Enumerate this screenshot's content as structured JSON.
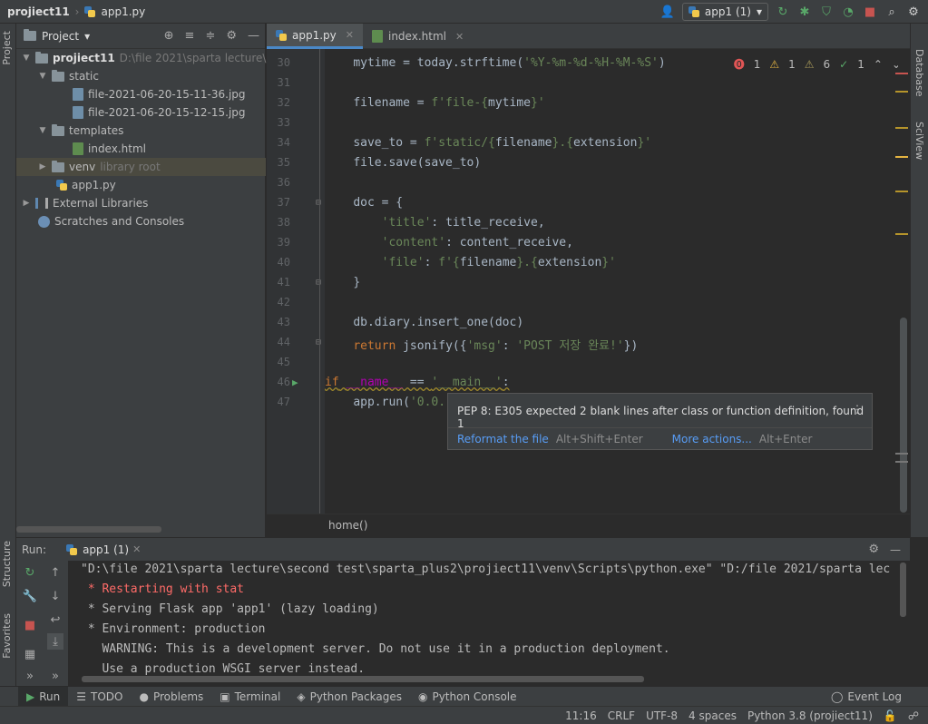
{
  "navbar": {
    "project": "projiect11",
    "file": "app1.py"
  },
  "toolbar": {
    "run_config": "app1 (1)"
  },
  "left_strip": {
    "project_label": "Project",
    "structure_label": "Structure",
    "favorites_label": "Favorites"
  },
  "right_strip": {
    "database_label": "Database",
    "sciview_label": "SciView"
  },
  "project_panel": {
    "title": "Project",
    "root": {
      "name": "projiect11",
      "path": "D:\\file 2021\\sparta lecture\\se"
    },
    "static": "static",
    "file1": "file-2021-06-20-15-11-36.jpg",
    "file2": "file-2021-06-20-15-12-15.jpg",
    "templates": "templates",
    "index": "index.html",
    "venv": "venv",
    "venv_hint": "library root",
    "app": "app1.py",
    "ext_libs": "External Libraries",
    "scratches": "Scratches and Consoles"
  },
  "editor": {
    "tabs": [
      {
        "label": "app1.py"
      },
      {
        "label": "index.html"
      }
    ],
    "inspections": {
      "errors": "1",
      "warnings": "1",
      "weak_warnings": "6",
      "typos": "1"
    },
    "line_numbers": [
      "30",
      "31",
      "32",
      "33",
      "34",
      "35",
      "36",
      "37",
      "38",
      "39",
      "40",
      "41",
      "42",
      "43",
      "44",
      "45",
      "46",
      "47"
    ],
    "breadcrumb": "home()"
  },
  "tooltip": {
    "message": "PEP 8: E305 expected 2 blank lines after class or function definition, found 1",
    "action1": "Reformat the file",
    "shortcut1": "Alt+Shift+Enter",
    "action2": "More actions...",
    "shortcut2": "Alt+Enter"
  },
  "run": {
    "label": "Run:",
    "tab": "app1 (1)",
    "console": [
      "\"D:\\file 2021\\sparta lecture\\second test\\sparta_plus2\\projiect11\\venv\\Scripts\\python.exe\" \"D:/file 2021/sparta lec",
      " * Restarting with stat",
      " * Serving Flask app 'app1' (lazy loading)",
      " * Environment: production",
      "   WARNING: This is a development server. Do not use it in a production deployment.",
      "   Use a production WSGI server instead."
    ]
  },
  "bottom_tabs": {
    "run": "Run",
    "todo": "TODO",
    "problems": "Problems",
    "terminal": "Terminal",
    "packages": "Python Packages",
    "console": "Python Console",
    "event_log": "Event Log"
  },
  "status": {
    "position": "11:16",
    "line_sep": "CRLF",
    "encoding": "UTF-8",
    "indent": "4 spaces",
    "interpreter": "Python 3.8 (projiect11)"
  },
  "code": {
    "l30": [
      "    ",
      "mytime = today.strftime(",
      "'%Y-%m-%d-%H-%M-%S'",
      ")"
    ],
    "l32": [
      "    ",
      "filename = ",
      "f'file-{",
      "mytime",
      "}'"
    ],
    "l34": [
      "    ",
      "save_to = ",
      "f'static/{",
      "filename",
      "}.{",
      "extension",
      "}'"
    ],
    "l35": [
      "    ",
      "file.save(save_to)"
    ],
    "l37": [
      "    ",
      "doc = {"
    ],
    "l38": [
      "        ",
      "'title'",
      ": title_receive,"
    ],
    "l39": [
      "        ",
      "'content'",
      ": content_receive,"
    ],
    "l40": [
      "        ",
      "'file'",
      ": ",
      "f'{",
      "filename",
      "}.{",
      "extension",
      "}'"
    ],
    "l41": [
      "    ",
      "}"
    ],
    "l43": [
      "    ",
      "db.diary.insert_one(doc)"
    ],
    "l44": [
      "    ",
      "return",
      " jsonify({",
      "'msg'",
      ": ",
      "'POST 저장 완료!'",
      "})"
    ],
    "l46": [
      "if",
      " ",
      "__name__",
      " == ",
      "'__main__'",
      ":"
    ],
    "l47": [
      "    ",
      "app.run(",
      "'0.0."
    ]
  }
}
